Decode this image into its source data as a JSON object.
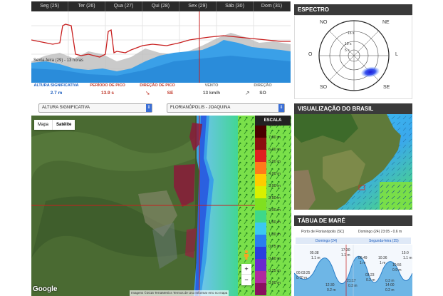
{
  "forecast": {
    "days": [
      "Seg (25)",
      "Ter (26)",
      "Qua (27)",
      "Qui (28)",
      "Sex (29)",
      "Sáb (30)",
      "Dom (31)"
    ],
    "caption": "Sexta-feira (29) - 13 horas",
    "labels": {
      "wave_height": "ALTURA SIGNIFICATIVA",
      "peak_period": "PERÍODO DE PICO",
      "peak_direction": "DIREÇÃO DE PICO",
      "wind": "VENTO",
      "direction": "DIREÇÃO"
    },
    "values": {
      "wave_height": "2.7 m",
      "peak_period": "13.9 s",
      "peak_direction": "SE",
      "wind": "13 km/h",
      "direction": "SO"
    },
    "colors": {
      "label_blue": "#1f5fbf",
      "label_red": "#c0392b",
      "label_gray": "#777777"
    }
  },
  "spectrum": {
    "title": "ESPECTRO",
    "directions": {
      "n": "NO",
      "ne": "NE",
      "e": "L",
      "w": "O",
      "sw": "SO",
      "se": "SE"
    },
    "rings": [
      "15 s",
      "10 s",
      "5 s"
    ]
  },
  "map_controls": {
    "variable": "ALTURA SIGNIFICATIVA",
    "location": "FLORIANÓPOLIS - JOAQUINA"
  },
  "map": {
    "type_map": "Mapa",
    "type_satellite": "Satélite",
    "scale_title": "ESCALA",
    "scale": [
      {
        "label": "8,00 m",
        "color": "#4a0000"
      },
      {
        "label": "7,00 m",
        "color": "#8b1010"
      },
      {
        "label": "6,00 m",
        "color": "#e02020"
      },
      {
        "label": "5,00 m",
        "color": "#ff7a1a"
      },
      {
        "label": "4,00 m",
        "color": "#ffcc00"
      },
      {
        "label": "3,00 m",
        "color": "#d8f000"
      },
      {
        "label": "2,50 m",
        "color": "#80e020"
      },
      {
        "label": "2,00 m",
        "color": "#3ed88a"
      },
      {
        "label": "1,50 m",
        "color": "#3cc8f0"
      },
      {
        "label": "1,00 m",
        "color": "#2a7ef0"
      },
      {
        "label": "0,75 m",
        "color": "#2a3ee0"
      },
      {
        "label": "0,50 m",
        "color": "#6a2ad0"
      },
      {
        "label": "0,25 m",
        "color": "#b02aa0"
      },
      {
        "label": "0,00 m",
        "color": "#8a1060"
      }
    ],
    "zoom_in": "+",
    "zoom_out": "−",
    "google": "Google",
    "attribution": "Imagens ©2016 TerraMetrics   Termos de Uso   Informar erro no mapa"
  },
  "brasil": {
    "title": "VISUALIZAÇÃO DO BRASIL"
  },
  "tide": {
    "title": "TÁBUA DE MARÉ",
    "port": "Porto de Florianópolis (SC)",
    "now": "Domingo (24) 23:05 - 0.6 m",
    "day1": "Domingo (24)",
    "day2": "Segunda-feira (25)",
    "highs": [
      {
        "time": "05:38",
        "height": "1.1 m"
      },
      {
        "time": "17:30",
        "height": "1.1 m"
      },
      {
        "time": "06:49",
        "height": "1 m"
      },
      {
        "time": "10:36",
        "height": "1 m"
      },
      {
        "time": "10:56",
        "height": "0.9 m"
      },
      {
        "time": "15:0",
        "height": "1.1 m"
      }
    ],
    "lows": [
      {
        "time": "00:03:25",
        "height": "0.70 m"
      },
      {
        "time": "12:30",
        "height": "0.2 m"
      },
      {
        "time": "21:17",
        "height": "0.3 m"
      },
      {
        "time": "03:23",
        "height": "0.2 m"
      },
      {
        "time": "0.3 m",
        "height": ""
      },
      {
        "time": "14:00",
        "height": "0.2 m"
      }
    ]
  }
}
